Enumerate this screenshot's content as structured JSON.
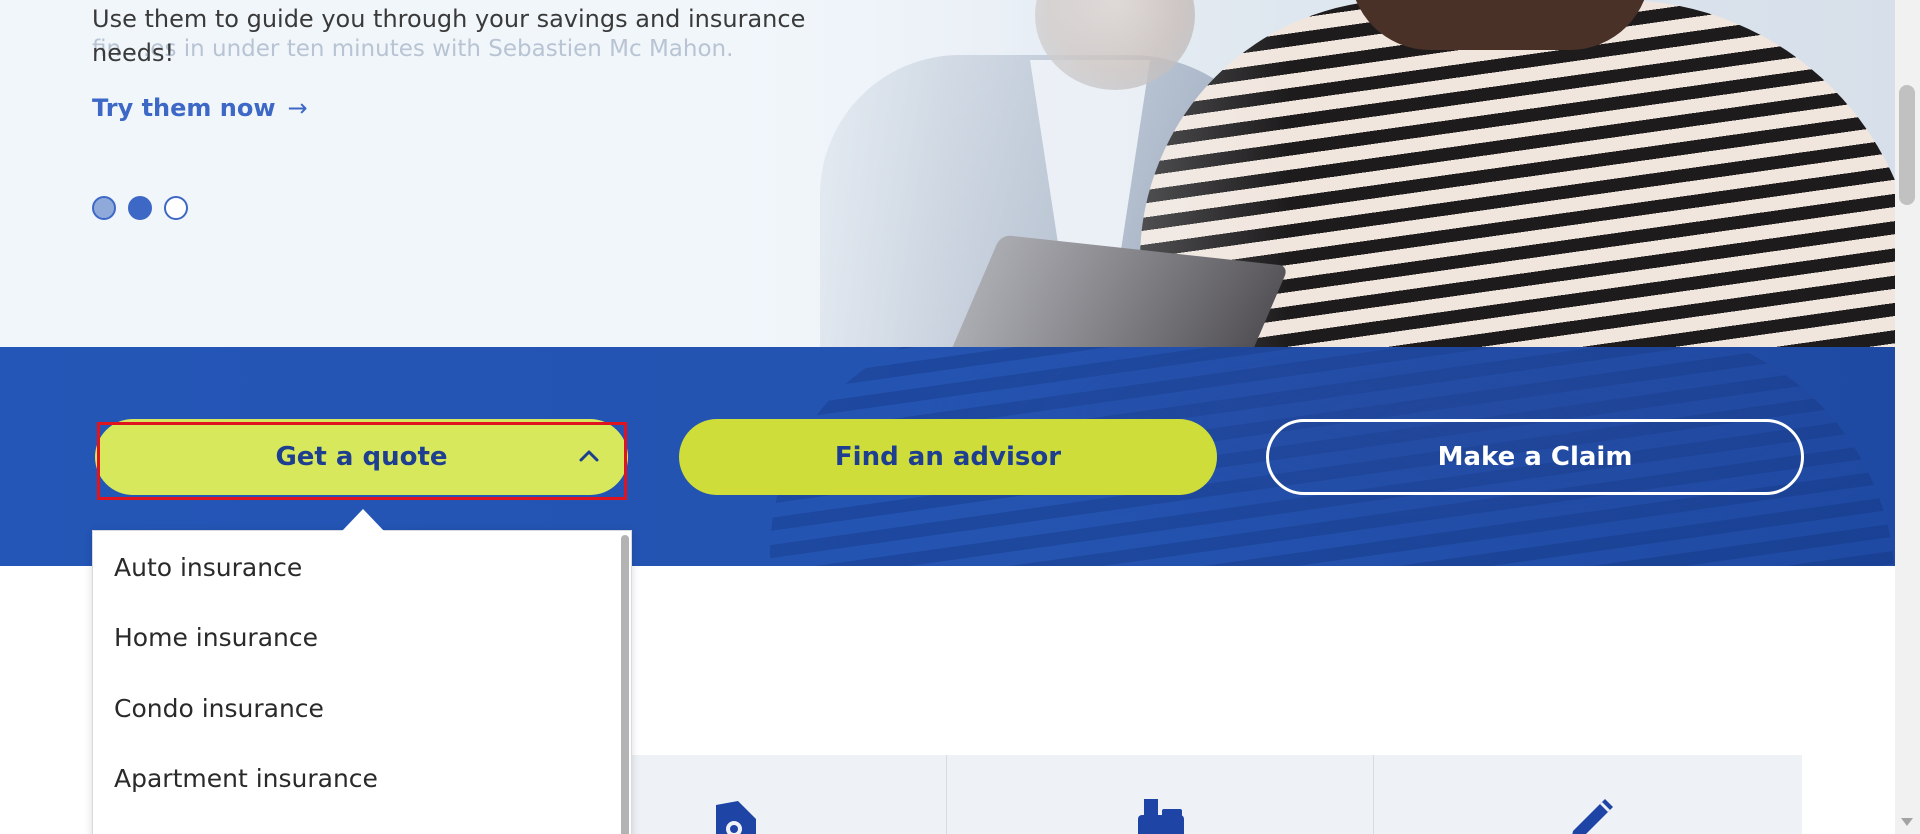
{
  "hero": {
    "ghost_text": "fin ...es in under ten minutes with Sebastien Mc Mahon.",
    "description": "Use them to guide you through your savings and insurance needs!",
    "cta_label": "Try them now",
    "cta_arrow": "→",
    "carousel": {
      "slide_count": 3,
      "active_index": 1
    }
  },
  "actions": {
    "quote_label": "Get a quote",
    "advisor_label": "Find an advisor",
    "claim_label": "Make a Claim"
  },
  "quote_menu": {
    "expanded": true,
    "items": [
      "Auto insurance",
      "Home insurance",
      "Condo insurance",
      "Apartment insurance"
    ]
  },
  "cards": {
    "icons": [
      "price-tag-icon",
      "mailbox-icon",
      "pencil-icon"
    ]
  },
  "colors": {
    "brand_blue": "#2456b7",
    "accent_lime": "#d8e85c",
    "link_blue": "#3d68c6",
    "focus_outline": "#e0141e"
  }
}
